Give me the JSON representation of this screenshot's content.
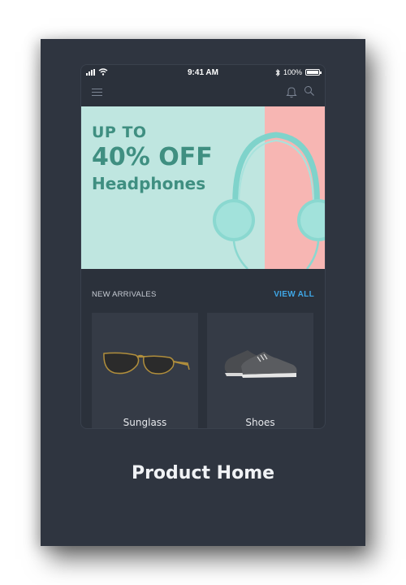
{
  "status_bar": {
    "time": "9:41 AM",
    "battery": "100%"
  },
  "banner": {
    "line1": "UP TO",
    "line2": "40% OFF",
    "line3": "Headphones"
  },
  "section": {
    "title": "NEW ARRIVALES",
    "view_all": "VIEW ALL"
  },
  "products": [
    {
      "name": "Sunglass"
    },
    {
      "name": "Shoes"
    }
  ],
  "caption": "Product Home",
  "colors": {
    "card_bg": "#2f3540",
    "banner_mint": "#bfe6e0",
    "banner_pink": "#f7b6b3",
    "banner_text": "#3f8f81",
    "accent": "#3fa7e6"
  },
  "icons": [
    "signal-icon",
    "wifi-icon",
    "bluetooth-icon",
    "battery-icon",
    "menu-icon",
    "bell-icon",
    "search-icon",
    "headphones-image",
    "sunglasses-image",
    "shoes-image"
  ]
}
